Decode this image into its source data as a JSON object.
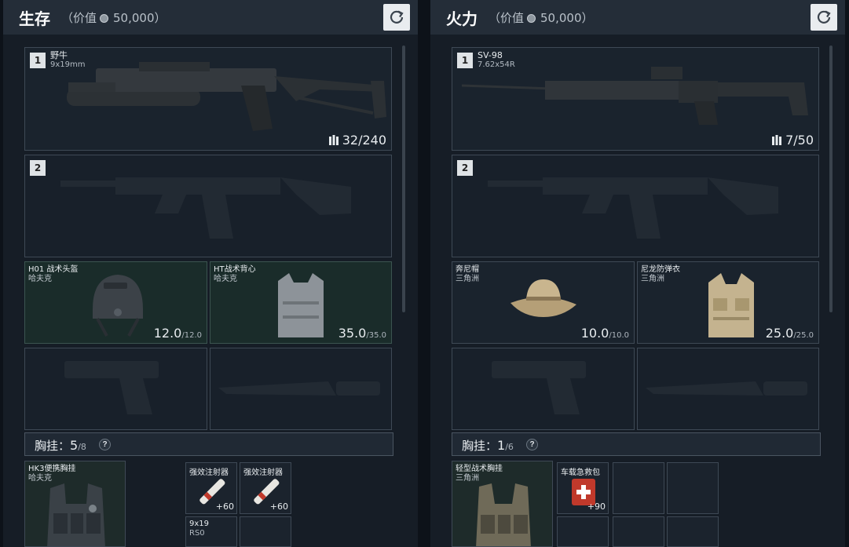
{
  "panels": [
    {
      "title": "生存",
      "value_label": "（价值",
      "value": "50,000）",
      "weapon1": {
        "num": "1",
        "name": "野牛",
        "caliber": "9x19mm",
        "ammo": "32/240"
      },
      "weapon2": {
        "num": "2"
      },
      "helmet": {
        "name": "H01 战术头盔",
        "brand": "哈夫克",
        "durability": "12.0",
        "max": "/12.0"
      },
      "armor": {
        "name": "HT战术背心",
        "brand": "哈夫克",
        "durability": "35.0",
        "max": "/35.0"
      },
      "rig": {
        "label": "胸挂：",
        "count": "5",
        "capacity": "/8",
        "help": "?"
      },
      "rig_item": {
        "name": "HK3便携胸挂",
        "brand": "哈夫克"
      },
      "inventory": [
        {
          "name": "强效注射器",
          "count": "+60"
        },
        {
          "name": "强效注射器",
          "count": "+60"
        },
        {
          "name": "9x19",
          "sub": "RS0"
        }
      ]
    },
    {
      "title": "火力",
      "value_label": "（价值",
      "value": "50,000）",
      "weapon1": {
        "num": "1",
        "name": "SV-98",
        "caliber": "7.62x54R",
        "ammo": "7/50"
      },
      "weapon2": {
        "num": "2"
      },
      "helmet": {
        "name": "奔尼帽",
        "brand": "三角洲",
        "durability": "10.0",
        "max": "/10.0"
      },
      "armor": {
        "name": "尼龙防弹衣",
        "brand": "三角洲",
        "durability": "25.0",
        "max": "/25.0"
      },
      "rig": {
        "label": "胸挂：",
        "count": "1",
        "capacity": "/6",
        "help": "?"
      },
      "rig_item": {
        "name": "轻型战术胸挂",
        "brand": "三角洲"
      },
      "inventory": [
        {
          "name": "车载急救包",
          "count": "+90"
        }
      ]
    }
  ],
  "icons": {
    "refresh": "refresh-icon",
    "coin": "coin-icon",
    "ammo": "ammo-icon"
  }
}
